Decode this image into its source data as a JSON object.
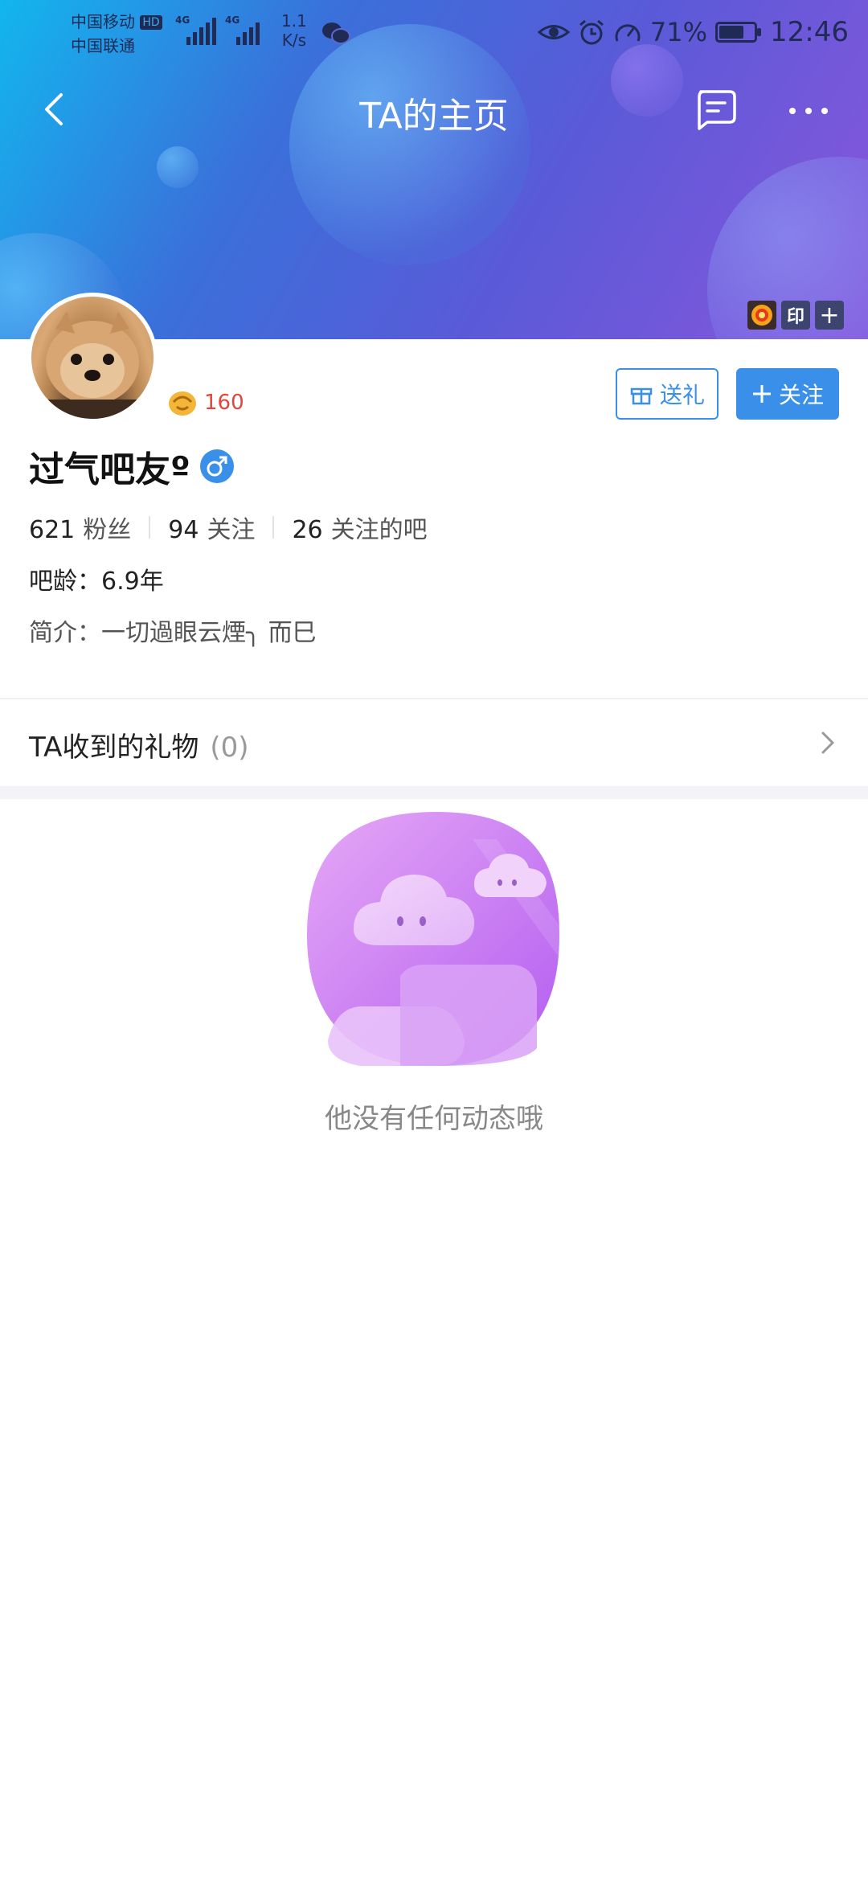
{
  "status_bar": {
    "carrier1": "中国移动",
    "hd": "HD",
    "carrier2": "中国联通",
    "net1": "4G",
    "net2": "4G",
    "speed_value": "1.1",
    "speed_unit": "K/s",
    "battery_pct": "71%",
    "battery_level": 0.71,
    "time": "12:46"
  },
  "nav": {
    "title": "TA的主页"
  },
  "badges": {
    "stamp": "印",
    "add": "+"
  },
  "profile": {
    "level": "160",
    "username": "过气吧友º",
    "gift_button": "送礼",
    "follow_button": "关注",
    "stats": [
      {
        "value": "621",
        "label": "粉丝"
      },
      {
        "value": "94",
        "label": "关注"
      },
      {
        "value": "26",
        "label": "关注的吧"
      }
    ],
    "age": "吧龄：6.9年",
    "bio": "简介：一切過眼云煙╮ 而巳"
  },
  "gifts": {
    "title": "TA收到的礼物",
    "count": "(0)"
  },
  "empty_state": {
    "message": "他没有任何动态哦"
  },
  "colors": {
    "accent": "#3a8fe8",
    "level_red": "#e3453c"
  }
}
